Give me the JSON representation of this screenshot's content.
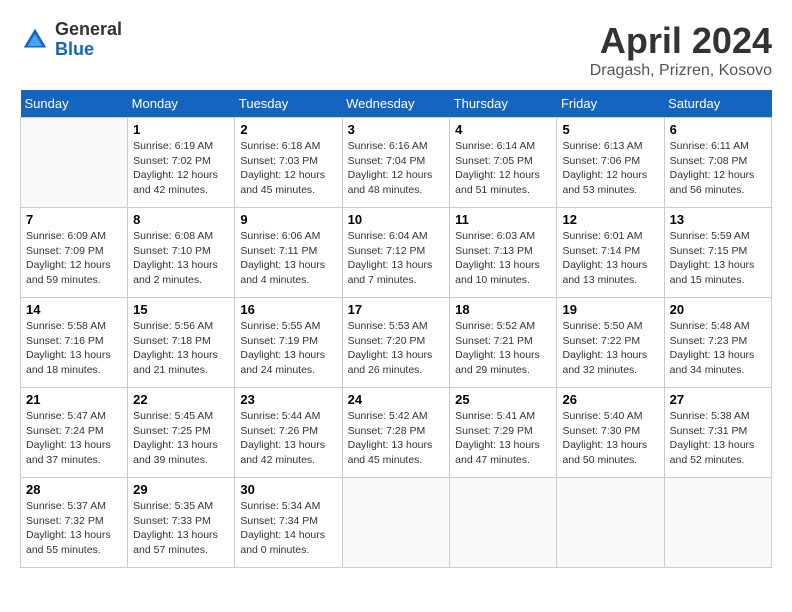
{
  "header": {
    "logo_general": "General",
    "logo_blue": "Blue",
    "month_title": "April 2024",
    "location": "Dragash, Prizren, Kosovo"
  },
  "weekdays": [
    "Sunday",
    "Monday",
    "Tuesday",
    "Wednesday",
    "Thursday",
    "Friday",
    "Saturday"
  ],
  "weeks": [
    [
      {
        "day": "",
        "sunrise": "",
        "sunset": "",
        "daylight": ""
      },
      {
        "day": "1",
        "sunrise": "Sunrise: 6:19 AM",
        "sunset": "Sunset: 7:02 PM",
        "daylight": "Daylight: 12 hours and 42 minutes."
      },
      {
        "day": "2",
        "sunrise": "Sunrise: 6:18 AM",
        "sunset": "Sunset: 7:03 PM",
        "daylight": "Daylight: 12 hours and 45 minutes."
      },
      {
        "day": "3",
        "sunrise": "Sunrise: 6:16 AM",
        "sunset": "Sunset: 7:04 PM",
        "daylight": "Daylight: 12 hours and 48 minutes."
      },
      {
        "day": "4",
        "sunrise": "Sunrise: 6:14 AM",
        "sunset": "Sunset: 7:05 PM",
        "daylight": "Daylight: 12 hours and 51 minutes."
      },
      {
        "day": "5",
        "sunrise": "Sunrise: 6:13 AM",
        "sunset": "Sunset: 7:06 PM",
        "daylight": "Daylight: 12 hours and 53 minutes."
      },
      {
        "day": "6",
        "sunrise": "Sunrise: 6:11 AM",
        "sunset": "Sunset: 7:08 PM",
        "daylight": "Daylight: 12 hours and 56 minutes."
      }
    ],
    [
      {
        "day": "7",
        "sunrise": "Sunrise: 6:09 AM",
        "sunset": "Sunset: 7:09 PM",
        "daylight": "Daylight: 12 hours and 59 minutes."
      },
      {
        "day": "8",
        "sunrise": "Sunrise: 6:08 AM",
        "sunset": "Sunset: 7:10 PM",
        "daylight": "Daylight: 13 hours and 2 minutes."
      },
      {
        "day": "9",
        "sunrise": "Sunrise: 6:06 AM",
        "sunset": "Sunset: 7:11 PM",
        "daylight": "Daylight: 13 hours and 4 minutes."
      },
      {
        "day": "10",
        "sunrise": "Sunrise: 6:04 AM",
        "sunset": "Sunset: 7:12 PM",
        "daylight": "Daylight: 13 hours and 7 minutes."
      },
      {
        "day": "11",
        "sunrise": "Sunrise: 6:03 AM",
        "sunset": "Sunset: 7:13 PM",
        "daylight": "Daylight: 13 hours and 10 minutes."
      },
      {
        "day": "12",
        "sunrise": "Sunrise: 6:01 AM",
        "sunset": "Sunset: 7:14 PM",
        "daylight": "Daylight: 13 hours and 13 minutes."
      },
      {
        "day": "13",
        "sunrise": "Sunrise: 5:59 AM",
        "sunset": "Sunset: 7:15 PM",
        "daylight": "Daylight: 13 hours and 15 minutes."
      }
    ],
    [
      {
        "day": "14",
        "sunrise": "Sunrise: 5:58 AM",
        "sunset": "Sunset: 7:16 PM",
        "daylight": "Daylight: 13 hours and 18 minutes."
      },
      {
        "day": "15",
        "sunrise": "Sunrise: 5:56 AM",
        "sunset": "Sunset: 7:18 PM",
        "daylight": "Daylight: 13 hours and 21 minutes."
      },
      {
        "day": "16",
        "sunrise": "Sunrise: 5:55 AM",
        "sunset": "Sunset: 7:19 PM",
        "daylight": "Daylight: 13 hours and 24 minutes."
      },
      {
        "day": "17",
        "sunrise": "Sunrise: 5:53 AM",
        "sunset": "Sunset: 7:20 PM",
        "daylight": "Daylight: 13 hours and 26 minutes."
      },
      {
        "day": "18",
        "sunrise": "Sunrise: 5:52 AM",
        "sunset": "Sunset: 7:21 PM",
        "daylight": "Daylight: 13 hours and 29 minutes."
      },
      {
        "day": "19",
        "sunrise": "Sunrise: 5:50 AM",
        "sunset": "Sunset: 7:22 PM",
        "daylight": "Daylight: 13 hours and 32 minutes."
      },
      {
        "day": "20",
        "sunrise": "Sunrise: 5:48 AM",
        "sunset": "Sunset: 7:23 PM",
        "daylight": "Daylight: 13 hours and 34 minutes."
      }
    ],
    [
      {
        "day": "21",
        "sunrise": "Sunrise: 5:47 AM",
        "sunset": "Sunset: 7:24 PM",
        "daylight": "Daylight: 13 hours and 37 minutes."
      },
      {
        "day": "22",
        "sunrise": "Sunrise: 5:45 AM",
        "sunset": "Sunset: 7:25 PM",
        "daylight": "Daylight: 13 hours and 39 minutes."
      },
      {
        "day": "23",
        "sunrise": "Sunrise: 5:44 AM",
        "sunset": "Sunset: 7:26 PM",
        "daylight": "Daylight: 13 hours and 42 minutes."
      },
      {
        "day": "24",
        "sunrise": "Sunrise: 5:42 AM",
        "sunset": "Sunset: 7:28 PM",
        "daylight": "Daylight: 13 hours and 45 minutes."
      },
      {
        "day": "25",
        "sunrise": "Sunrise: 5:41 AM",
        "sunset": "Sunset: 7:29 PM",
        "daylight": "Daylight: 13 hours and 47 minutes."
      },
      {
        "day": "26",
        "sunrise": "Sunrise: 5:40 AM",
        "sunset": "Sunset: 7:30 PM",
        "daylight": "Daylight: 13 hours and 50 minutes."
      },
      {
        "day": "27",
        "sunrise": "Sunrise: 5:38 AM",
        "sunset": "Sunset: 7:31 PM",
        "daylight": "Daylight: 13 hours and 52 minutes."
      }
    ],
    [
      {
        "day": "28",
        "sunrise": "Sunrise: 5:37 AM",
        "sunset": "Sunset: 7:32 PM",
        "daylight": "Daylight: 13 hours and 55 minutes."
      },
      {
        "day": "29",
        "sunrise": "Sunrise: 5:35 AM",
        "sunset": "Sunset: 7:33 PM",
        "daylight": "Daylight: 13 hours and 57 minutes."
      },
      {
        "day": "30",
        "sunrise": "Sunrise: 5:34 AM",
        "sunset": "Sunset: 7:34 PM",
        "daylight": "Daylight: 14 hours and 0 minutes."
      },
      {
        "day": "",
        "sunrise": "",
        "sunset": "",
        "daylight": ""
      },
      {
        "day": "",
        "sunrise": "",
        "sunset": "",
        "daylight": ""
      },
      {
        "day": "",
        "sunrise": "",
        "sunset": "",
        "daylight": ""
      },
      {
        "day": "",
        "sunrise": "",
        "sunset": "",
        "daylight": ""
      }
    ]
  ]
}
